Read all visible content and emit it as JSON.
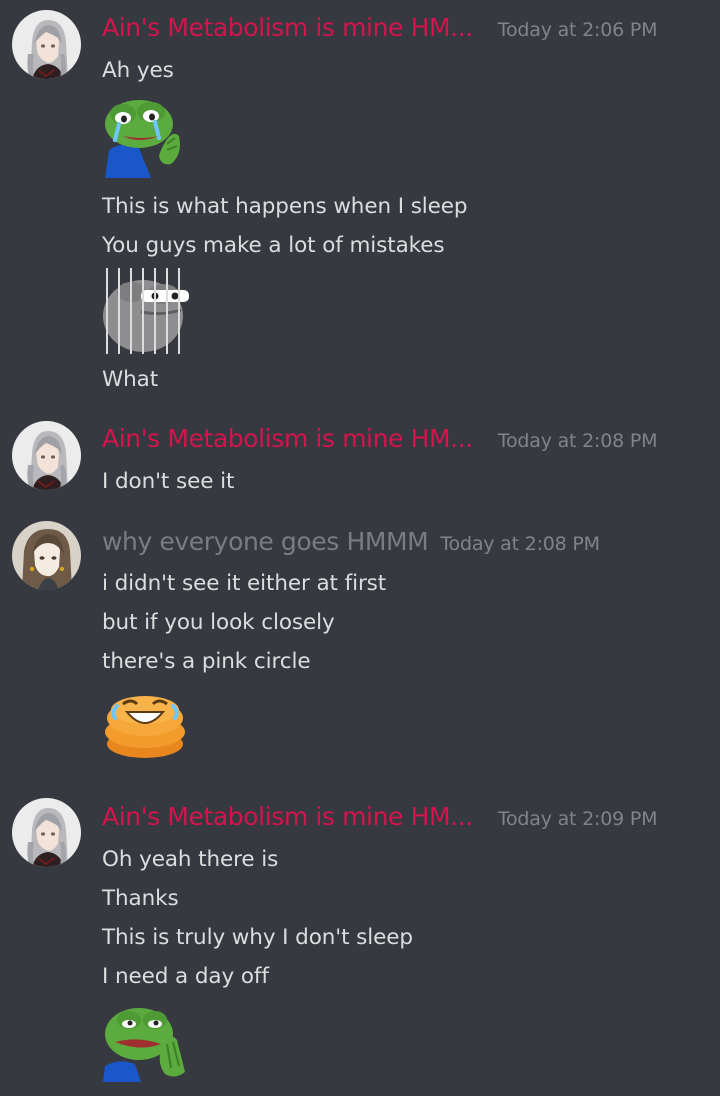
{
  "colors": {
    "background": "#36393f",
    "message_text": "#dcddde",
    "timestamp_text": "#7f848b",
    "username_ain": "#d3144d",
    "username_why": "#787c84"
  },
  "messages": [
    {
      "username": "Ain's Metabolism is mine HM...",
      "timestamp": "Today at 2:06 PM",
      "avatar": "anime-girl-silver-hair-avatar",
      "lines": [
        "Ah yes",
        "This is what happens when I sleep",
        "You guys make a lot of mistakes",
        "What"
      ],
      "emotes": [
        "pepe-crying-emote",
        "pepe-behind-bars-emote"
      ]
    },
    {
      "username": "Ain's Metabolism is mine HM...",
      "timestamp": "Today at 2:08 PM",
      "avatar": "anime-girl-silver-hair-avatar",
      "lines": [
        "I don't see it"
      ]
    },
    {
      "username": "why everyone goes HMMM",
      "timestamp": "Today at 2:08 PM",
      "avatar": "anime-girl-brown-hair-avatar",
      "lines": [
        "i didn't see it either at first",
        "but if you look closely",
        "there's a pink circle"
      ],
      "emotes": [
        "pancake-laughing-emote"
      ]
    },
    {
      "username": "Ain's Metabolism is mine HM...",
      "timestamp": "Today at 2:09 PM",
      "avatar": "anime-girl-silver-hair-avatar",
      "lines": [
        "Oh yeah there is",
        "Thanks",
        "This is truly why I don't sleep",
        "I need a day off"
      ],
      "emotes": [
        "pepe-pray-emote"
      ]
    }
  ]
}
